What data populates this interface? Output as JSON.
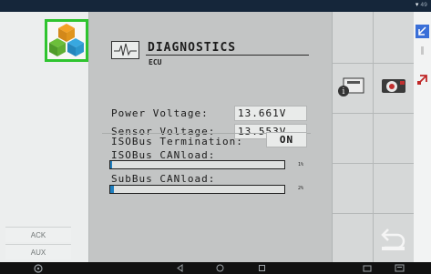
{
  "status_bar": {
    "glyph": "▾",
    "extra": "49"
  },
  "left": {
    "buttons": [
      "ACK",
      "AUX"
    ]
  },
  "header": {
    "title": "DIAGNOSTICS",
    "subtitle": "ECU"
  },
  "readings": [
    {
      "label": "Power Voltage:",
      "value": "13.661V"
    },
    {
      "label": "Sensor Voltage:",
      "value": "13.553V"
    }
  ],
  "isobus": {
    "termination_label": "ISOBus Termination:",
    "termination_value": "ON",
    "canload_label": "ISOBus CANload:",
    "canload_percent": 1,
    "canload_text": "1%",
    "subbus_label": "SubBus CANload:",
    "subbus_percent": 2,
    "subbus_text": "2%"
  },
  "colors": {
    "accent": "#2fc42f",
    "bar_fill": "#1f7fbf",
    "status_bar": "#15263a"
  },
  "icons": [
    "app-logo-icon",
    "waveform-icon",
    "info-module-icon",
    "camera-icon",
    "back-icon",
    "edit-icon",
    "collapse-icon",
    "close-icon",
    "steering-wheel-icon",
    "nav-back-icon",
    "nav-home-icon",
    "nav-recent-icon"
  ]
}
